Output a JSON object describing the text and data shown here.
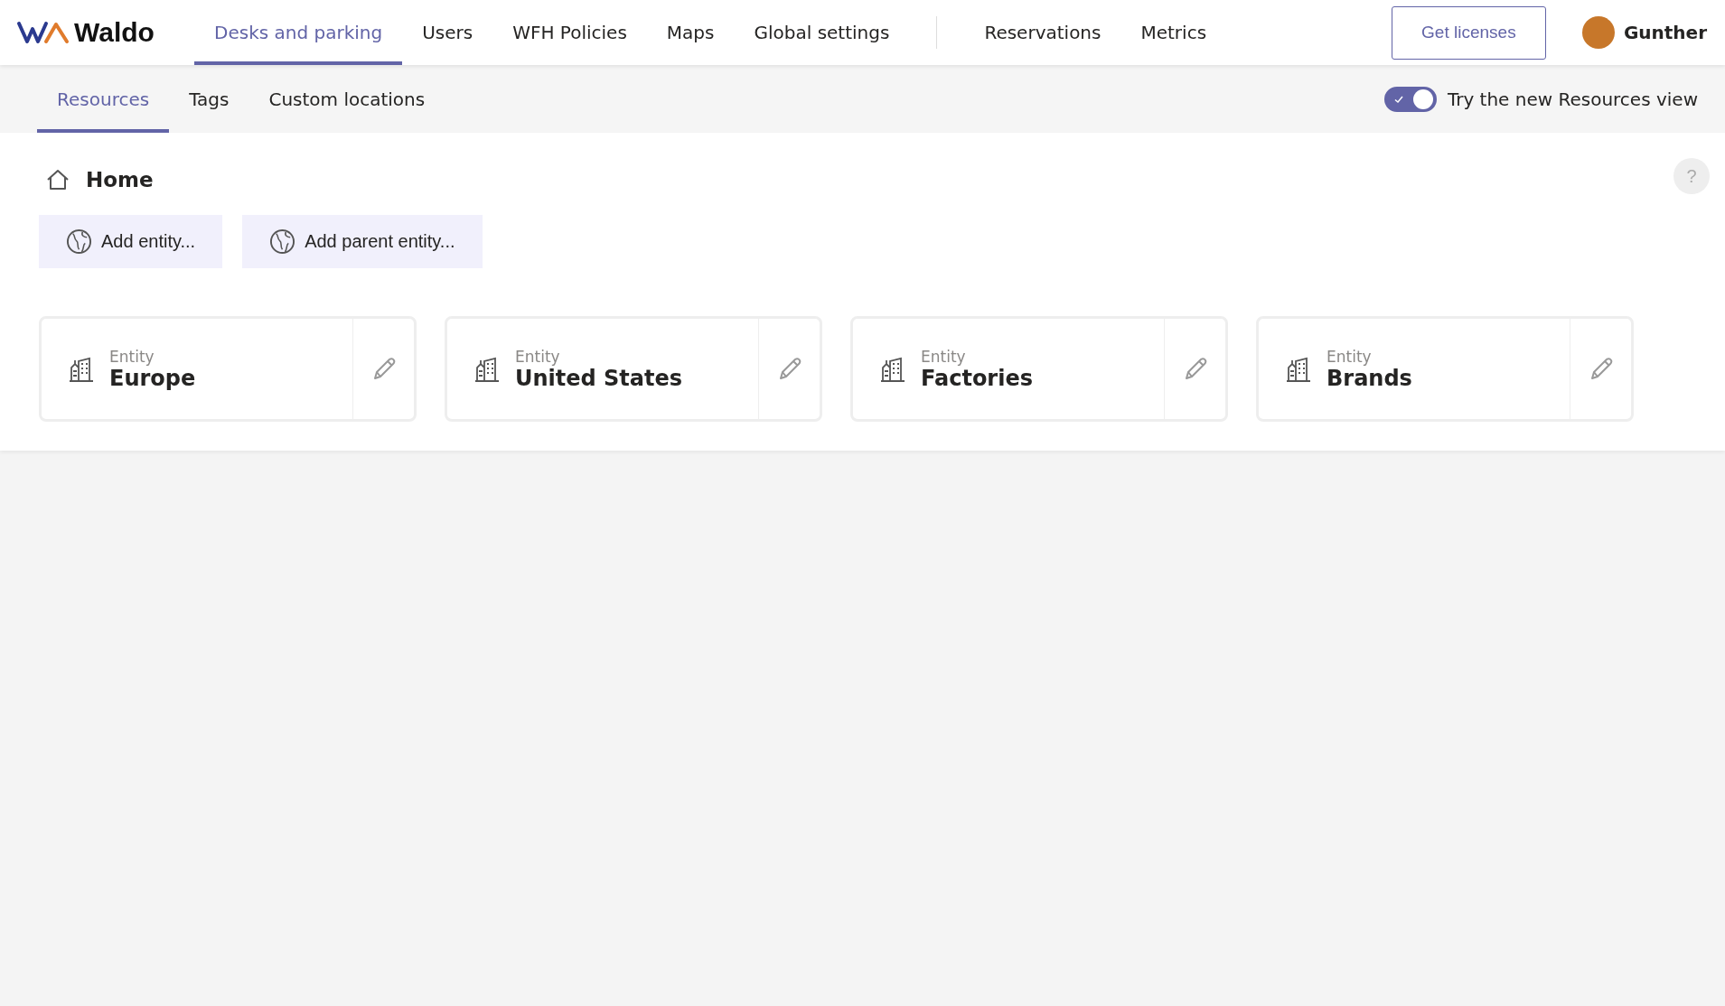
{
  "brand": {
    "name": "Waldo"
  },
  "nav": [
    {
      "label": "Desks and parking",
      "selected": true
    },
    {
      "label": "Users",
      "selected": false
    },
    {
      "label": "WFH Policies",
      "selected": false
    },
    {
      "label": "Maps",
      "selected": false
    },
    {
      "label": "Global settings",
      "selected": false
    }
  ],
  "nav_secondary": [
    {
      "label": "Reservations",
      "selected": false
    },
    {
      "label": "Metrics",
      "selected": false
    }
  ],
  "get_licenses": "Get licenses",
  "user": {
    "name": "Gunther"
  },
  "subtabs": [
    {
      "label": "Resources",
      "selected": true
    },
    {
      "label": "Tags",
      "selected": false
    },
    {
      "label": "Custom locations",
      "selected": false
    }
  ],
  "new_view_toggle": {
    "label": "Try the new Resources view",
    "on": true
  },
  "breadcrumb": "Home",
  "help": "?",
  "actions": [
    "Add entity...",
    "Add parent entity..."
  ],
  "entities": [
    {
      "type": "Entity",
      "name": "Europe"
    },
    {
      "type": "Entity",
      "name": "United States"
    },
    {
      "type": "Entity",
      "name": "Factories"
    },
    {
      "type": "Entity",
      "name": "Brands"
    }
  ]
}
